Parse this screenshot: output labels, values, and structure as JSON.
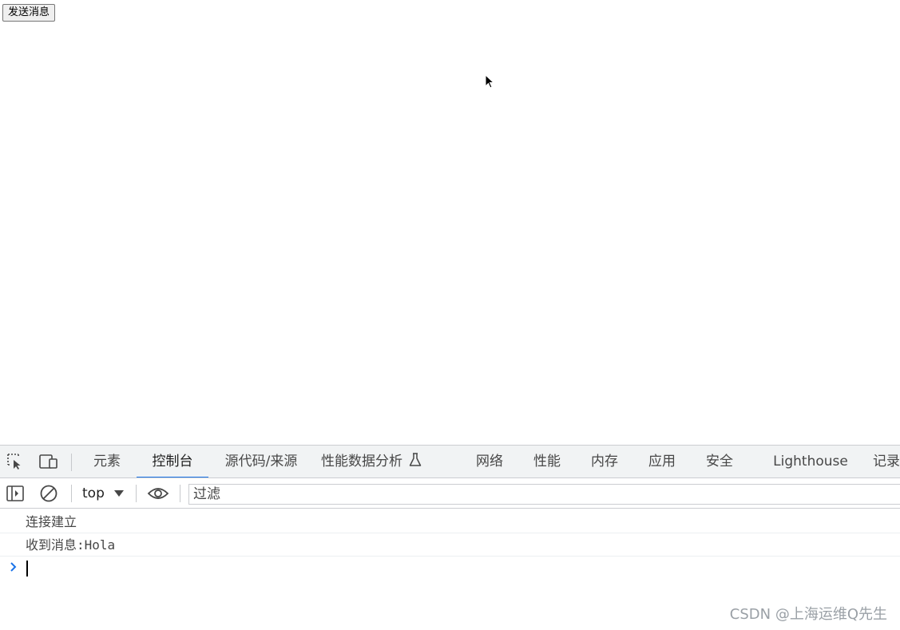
{
  "page": {
    "send_button_label": "发送消息"
  },
  "devtools": {
    "tabs": [
      {
        "label": "元素"
      },
      {
        "label": "控制台"
      },
      {
        "label": "源代码/来源"
      },
      {
        "label": "性能数据分析"
      },
      {
        "label": "网络"
      },
      {
        "label": "性能"
      },
      {
        "label": "内存"
      },
      {
        "label": "应用"
      },
      {
        "label": "安全"
      },
      {
        "label": "Lighthouse"
      },
      {
        "label": "记录"
      }
    ],
    "active_tab": "控制台",
    "toolbar": {
      "context": "top",
      "filter_placeholder": "过滤"
    },
    "console_logs": [
      {
        "text": "连接建立"
      },
      {
        "text": "收到消息:Hola"
      }
    ],
    "accent_color": "#1a73e8"
  },
  "watermark": "CSDN @上海运维Q先生"
}
